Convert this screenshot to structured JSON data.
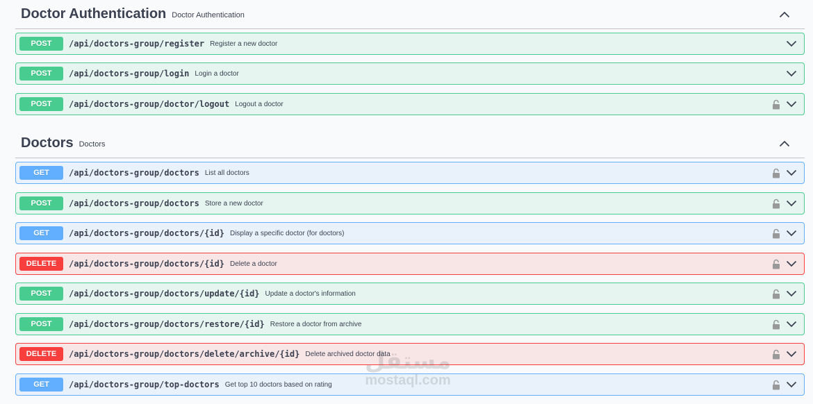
{
  "sections": [
    {
      "title": "Doctor Authentication",
      "description": "Doctor Authentication",
      "operations": [
        {
          "method": "POST",
          "path": "/api/doctors-group/register",
          "summary": "Register a new doctor",
          "locked": false
        },
        {
          "method": "POST",
          "path": "/api/doctors-group/login",
          "summary": "Login a doctor",
          "locked": false
        },
        {
          "method": "POST",
          "path": "/api/doctors-group/doctor/logout",
          "summary": "Logout a doctor",
          "locked": true
        }
      ]
    },
    {
      "title": "Doctors",
      "description": "Doctors",
      "operations": [
        {
          "method": "GET",
          "path": "/api/doctors-group/doctors",
          "summary": "List all doctors",
          "locked": true
        },
        {
          "method": "POST",
          "path": "/api/doctors-group/doctors",
          "summary": "Store a new doctor",
          "locked": true
        },
        {
          "method": "GET",
          "path": "/api/doctors-group/doctors/{id}",
          "summary": "Display a specific doctor (for doctors)",
          "locked": true
        },
        {
          "method": "DELETE",
          "path": "/api/doctors-group/doctors/{id}",
          "summary": "Delete a doctor",
          "locked": true
        },
        {
          "method": "POST",
          "path": "/api/doctors-group/doctors/update/{id}",
          "summary": "Update a doctor's information",
          "locked": true
        },
        {
          "method": "POST",
          "path": "/api/doctors-group/doctors/restore/{id}",
          "summary": "Restore a doctor from archive",
          "locked": true
        },
        {
          "method": "DELETE",
          "path": "/api/doctors-group/doctors/delete/archive/{id}",
          "summary": "Delete archived doctor data",
          "locked": true
        },
        {
          "method": "GET",
          "path": "/api/doctors-group/top-doctors",
          "summary": "Get top 10 doctors based on rating",
          "locked": true
        }
      ]
    }
  ],
  "watermark": {
    "arabic": "مستقل",
    "latin": "mostaql.com"
  },
  "colors": {
    "post": "#49cc90",
    "get": "#61affe",
    "delete": "#f93e3e",
    "text": "#3b4151"
  },
  "icons": {
    "section_toggle": "chevron-up-icon",
    "row_toggle": "chevron-down-icon",
    "auth": "lock-open-icon"
  }
}
